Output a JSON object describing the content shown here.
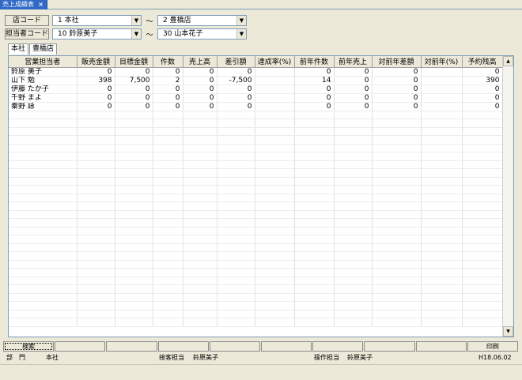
{
  "window": {
    "tab_title": "売上成績表",
    "close_glyph": "×"
  },
  "criteria": {
    "store_label": "店コード",
    "store_from": "1 本社",
    "store_to": "2 豊橋店",
    "staff_label": "担当者コード",
    "staff_from": "10 鈴原美子",
    "staff_to": "30 山本花子",
    "range_sep": "～"
  },
  "tabs": [
    "本社",
    "豊橋店"
  ],
  "table": {
    "headers": [
      "営業担当者",
      "販売金額",
      "目標金額",
      "件数",
      "売上高",
      "差引額",
      "達成率(%)",
      "前年件数",
      "前年売上",
      "対前年差額",
      "対前年(%)",
      "予約残高"
    ],
    "rows": [
      [
        "鈴原 美子",
        "0",
        "0",
        "0",
        "0",
        "0",
        "",
        "0",
        "0",
        "0",
        "",
        "0"
      ],
      [
        "山下 勉",
        "398",
        "7,500",
        "2",
        "0",
        "-7,500",
        "",
        "14",
        "0",
        "0",
        "",
        "390"
      ],
      [
        "伊藤 たか子",
        "0",
        "0",
        "0",
        "0",
        "0",
        "",
        "0",
        "0",
        "0",
        "",
        "0"
      ],
      [
        "千野 まよ",
        "0",
        "0",
        "0",
        "0",
        "0",
        "",
        "0",
        "0",
        "0",
        "",
        "0"
      ],
      [
        "秦野 詠",
        "0",
        "0",
        "0",
        "0",
        "0",
        "",
        "0",
        "0",
        "0",
        "",
        "0"
      ]
    ]
  },
  "fkeys": [
    "検索",
    "",
    "",
    "",
    "",
    "",
    "",
    "",
    "",
    "印刷"
  ],
  "status": {
    "dept_label": "部　門",
    "dept_value": "本社",
    "login_label": "接客担当",
    "login_value": "鈴原美子",
    "op_label": "操作担当",
    "op_value": "鈴原美子",
    "date": "H18.06.02"
  }
}
